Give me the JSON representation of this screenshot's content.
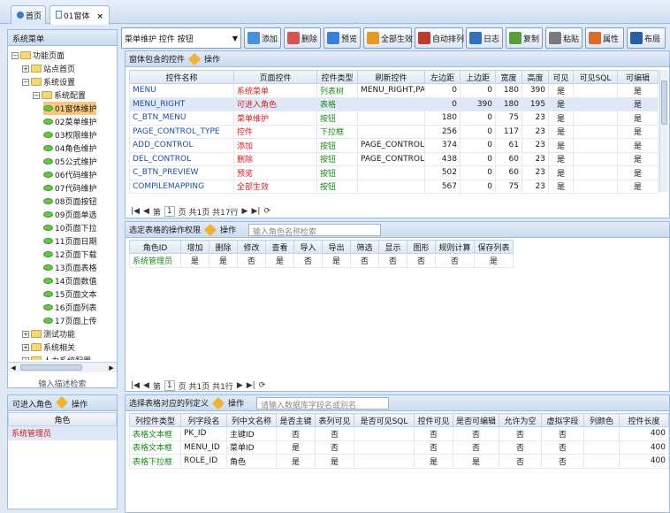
{
  "tabs": [
    {
      "label": "首页",
      "close": ""
    },
    {
      "label": "01窗体",
      "close": "×"
    }
  ],
  "left_panel": {
    "title": "系统菜单",
    "footer": "输入描述检索",
    "tree": [
      {
        "label": "功能页面",
        "level": 0,
        "kind": "folder",
        "expander": "−"
      },
      {
        "label": "站点首页",
        "level": 1,
        "kind": "folder",
        "expander": "+"
      },
      {
        "label": "系统设置",
        "level": 1,
        "kind": "folder",
        "expander": "−"
      },
      {
        "label": "系统配置",
        "level": 2,
        "kind": "folder",
        "expander": "−"
      },
      {
        "label": "01窗体维护",
        "level": 3,
        "kind": "leaf",
        "selected": true
      },
      {
        "label": "02菜单维护",
        "level": 3,
        "kind": "leaf"
      },
      {
        "label": "03权限维护",
        "level": 3,
        "kind": "leaf"
      },
      {
        "label": "04角色维护",
        "level": 3,
        "kind": "leaf"
      },
      {
        "label": "05公式维护",
        "level": 3,
        "kind": "leaf"
      },
      {
        "label": "06代码维护",
        "level": 3,
        "kind": "leaf"
      },
      {
        "label": "07代码维护",
        "level": 3,
        "kind": "leaf"
      },
      {
        "label": "08页面按钮",
        "level": 3,
        "kind": "leaf"
      },
      {
        "label": "09页面单选",
        "level": 3,
        "kind": "leaf"
      },
      {
        "label": "10页面下拉",
        "level": 3,
        "kind": "leaf"
      },
      {
        "label": "11页面日期",
        "level": 3,
        "kind": "leaf"
      },
      {
        "label": "12页面下载",
        "level": 3,
        "kind": "leaf"
      },
      {
        "label": "13页面表格",
        "level": 3,
        "kind": "leaf"
      },
      {
        "label": "14页面数值",
        "level": 3,
        "kind": "leaf"
      },
      {
        "label": "15页面文本",
        "level": 3,
        "kind": "leaf"
      },
      {
        "label": "16页面列表",
        "level": 3,
        "kind": "leaf"
      },
      {
        "label": "17页面上传",
        "level": 3,
        "kind": "leaf"
      },
      {
        "label": "测试功能",
        "level": 1,
        "kind": "folder",
        "expander": "+"
      },
      {
        "label": "系统相关",
        "level": 1,
        "kind": "folder",
        "expander": "+"
      },
      {
        "label": "人力系统配置",
        "level": 1,
        "kind": "folder",
        "expander": "+"
      }
    ]
  },
  "toolbar": {
    "combo_value": "菜单维护 控件 按钮",
    "buttons": [
      {
        "label": "添加",
        "color": "#4a90d9"
      },
      {
        "label": "删除",
        "color": "#d9534f"
      },
      {
        "label": "预览",
        "color": "#3b7dd8"
      },
      {
        "label": "全部生效",
        "color": "#e69a28"
      },
      {
        "label": "自动排列",
        "color": "#c0392b"
      },
      {
        "label": "日志",
        "color": "#2f6fbf"
      },
      {
        "label": "复制",
        "color": "#5a9e3c"
      },
      {
        "label": "粘贴",
        "color": "#7a7a7a"
      },
      {
        "label": "属性",
        "color": "#d96b2b"
      },
      {
        "label": "布局",
        "color": "#2a5fa8"
      }
    ]
  },
  "controls_panel": {
    "title": "窗体包含的控件",
    "action": "操作",
    "columns": [
      "控件名称",
      "页面控件",
      "控件类型",
      "刷新控件",
      "左边距",
      "上边距",
      "宽度",
      "高度",
      "可见",
      "可见SQL",
      "可编辑"
    ],
    "rows": [
      [
        "MENU",
        "系统菜单",
        "列表树",
        "MENU_RIGHT,PA",
        "0",
        "0",
        "180",
        "390",
        "是",
        "",
        "是"
      ],
      [
        "MENU_RIGHT",
        "可进入角色",
        "表格",
        "",
        "0",
        "390",
        "180",
        "195",
        "是",
        "",
        "是"
      ],
      [
        "C_BTN_MENU",
        "菜单维护",
        "按钮",
        "",
        "180",
        "0",
        "75",
        "23",
        "是",
        "",
        "是"
      ],
      [
        "PAGE_CONTROL_TYPE",
        "控件",
        "下拉框",
        "",
        "256",
        "0",
        "117",
        "23",
        "是",
        "",
        "是"
      ],
      [
        "ADD_CONTROL",
        "添加",
        "按钮",
        "PAGE_CONTROL",
        "374",
        "0",
        "61",
        "23",
        "是",
        "",
        "是"
      ],
      [
        "DEL_CONTROL",
        "删除",
        "按钮",
        "PAGE_CONTROL",
        "438",
        "0",
        "60",
        "23",
        "是",
        "",
        "是"
      ],
      [
        "C_BTN_PREVIEW",
        "预览",
        "按钮",
        "",
        "502",
        "0",
        "60",
        "23",
        "是",
        "",
        "是"
      ],
      [
        "COMPILEMAPPING",
        "全部生效",
        "按钮",
        "",
        "567",
        "0",
        "75",
        "23",
        "是",
        "",
        "是"
      ]
    ],
    "pager": {
      "prefix": "第",
      "page": "1",
      "suffix": "页 共1页 共17行"
    }
  },
  "perm_panel": {
    "title": "选定表格的操作权限",
    "action": "操作",
    "search_placeholder": "输入角色名称检索",
    "columns": [
      "角色ID",
      "增加",
      "删除",
      "修改",
      "查看",
      "导入",
      "导出",
      "筛选",
      "显示",
      "图形",
      "规则计算",
      "保存列表"
    ],
    "rows": [
      [
        "系统管理员",
        "是",
        "是",
        "否",
        "是",
        "否",
        "是",
        "否",
        "否",
        "否",
        "否",
        "是"
      ]
    ],
    "pager": {
      "prefix": "第",
      "page": "1",
      "suffix": "页 共1页 共1行"
    }
  },
  "role_panel": {
    "title": "可进入角色",
    "action": "操作",
    "column": "角色",
    "rows": [
      "系统管理员"
    ]
  },
  "column_panel": {
    "title": "选择表格对应的列定义",
    "action": "操作",
    "search_placeholder": "请输入数据库字段名或别名",
    "columns": [
      "列控件类型",
      "列字段名",
      "列中文名称",
      "是否主键",
      "表列可见",
      "是否可见SQL",
      "控件可见",
      "是否可编辑",
      "允许为空",
      "虚拟字段",
      "列颜色",
      "控件长度"
    ],
    "rows": [
      [
        "表格文本框",
        "PK_ID",
        "主键ID",
        "否",
        "否",
        "",
        "否",
        "否",
        "否",
        "否",
        "",
        "400"
      ],
      [
        "表格文本框",
        "MENU_ID",
        "菜单ID",
        "是",
        "否",
        "",
        "否",
        "否",
        "否",
        "否",
        "",
        "400"
      ],
      [
        "表格下拉框",
        "ROLE_ID",
        "角色",
        "是",
        "是",
        "",
        "是",
        "是",
        "否",
        "否",
        "",
        "400"
      ]
    ]
  }
}
